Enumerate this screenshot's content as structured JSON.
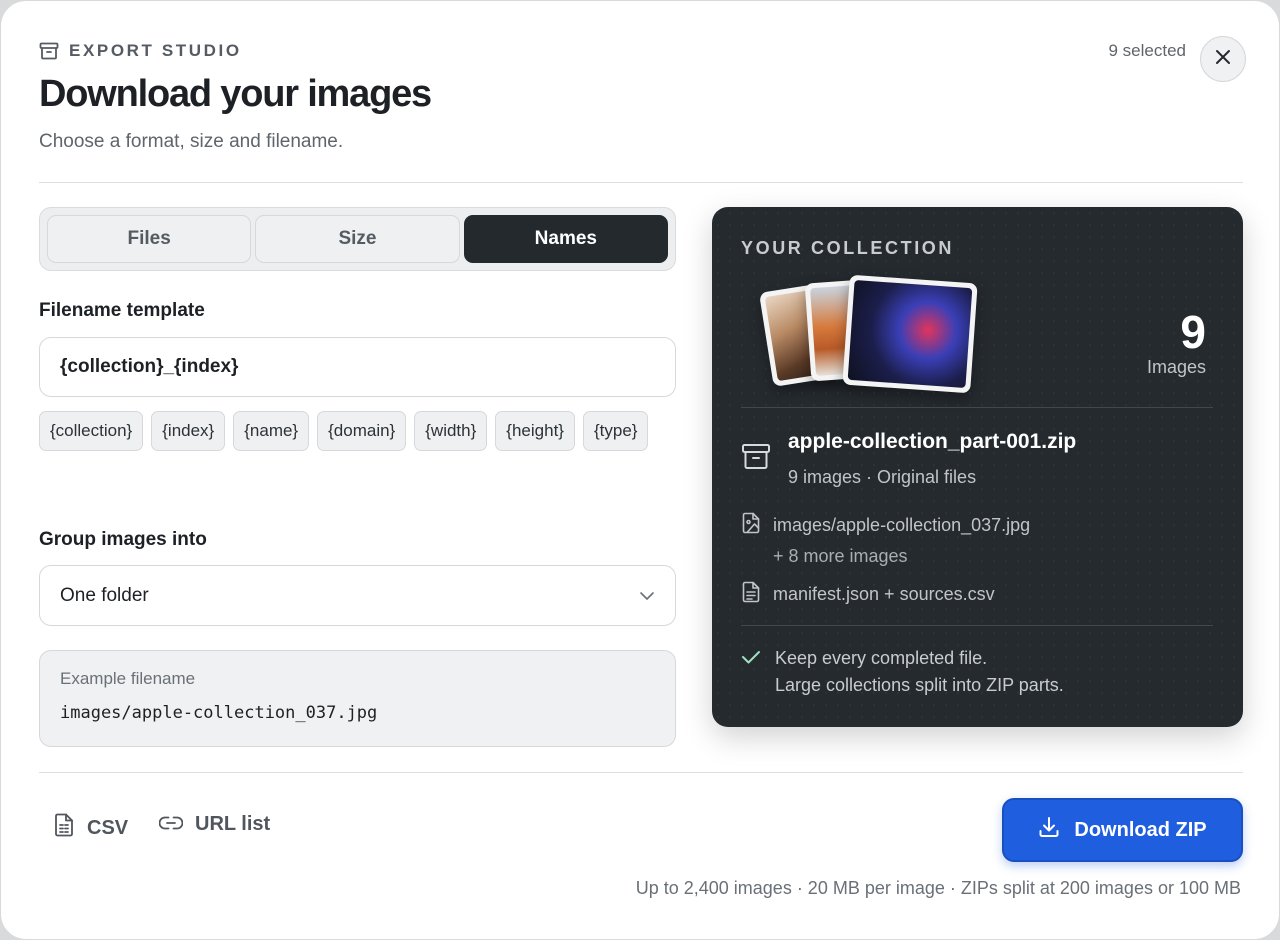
{
  "header": {
    "eyebrow": "EXPORT STUDIO",
    "title": "Download your images",
    "subtitle": "Choose a format, size and filename.",
    "selected_count": "9 selected"
  },
  "tabs": [
    {
      "label": "Files",
      "active": false
    },
    {
      "label": "Size",
      "active": false
    },
    {
      "label": "Names",
      "active": true
    }
  ],
  "filename": {
    "label": "Filename template",
    "value": "{collection}_{index}",
    "tokens": [
      "{collection}",
      "{index}",
      "{name}",
      "{domain}",
      "{width}",
      "{height}",
      "{type}"
    ]
  },
  "group": {
    "label": "Group images into",
    "selected": "One folder"
  },
  "example": {
    "label": "Example filename",
    "value": "images/apple-collection_037.jpg"
  },
  "collection": {
    "eyebrow": "YOUR COLLECTION",
    "count": "9",
    "count_label": "Images",
    "zip_name": "apple-collection_part-001.zip",
    "zip_meta": "9 images · Original files",
    "first_file": "images/apple-collection_037.jpg",
    "more_files": "+ 8 more images",
    "manifest": "manifest.json + sources.csv",
    "note_line1": "Keep every completed file.",
    "note_line2": "Large collections split into ZIP parts."
  },
  "footer": {
    "csv_label": "CSV",
    "url_list_label": "URL list",
    "download_label": "Download ZIP",
    "footnote": "Up to 2,400 images · 20 MB per image · ZIPs split at 200 images or 100 MB"
  },
  "colors": {
    "accent": "#1f5ede",
    "dark_panel": "#252a2f",
    "active_tab": "#24292e"
  }
}
